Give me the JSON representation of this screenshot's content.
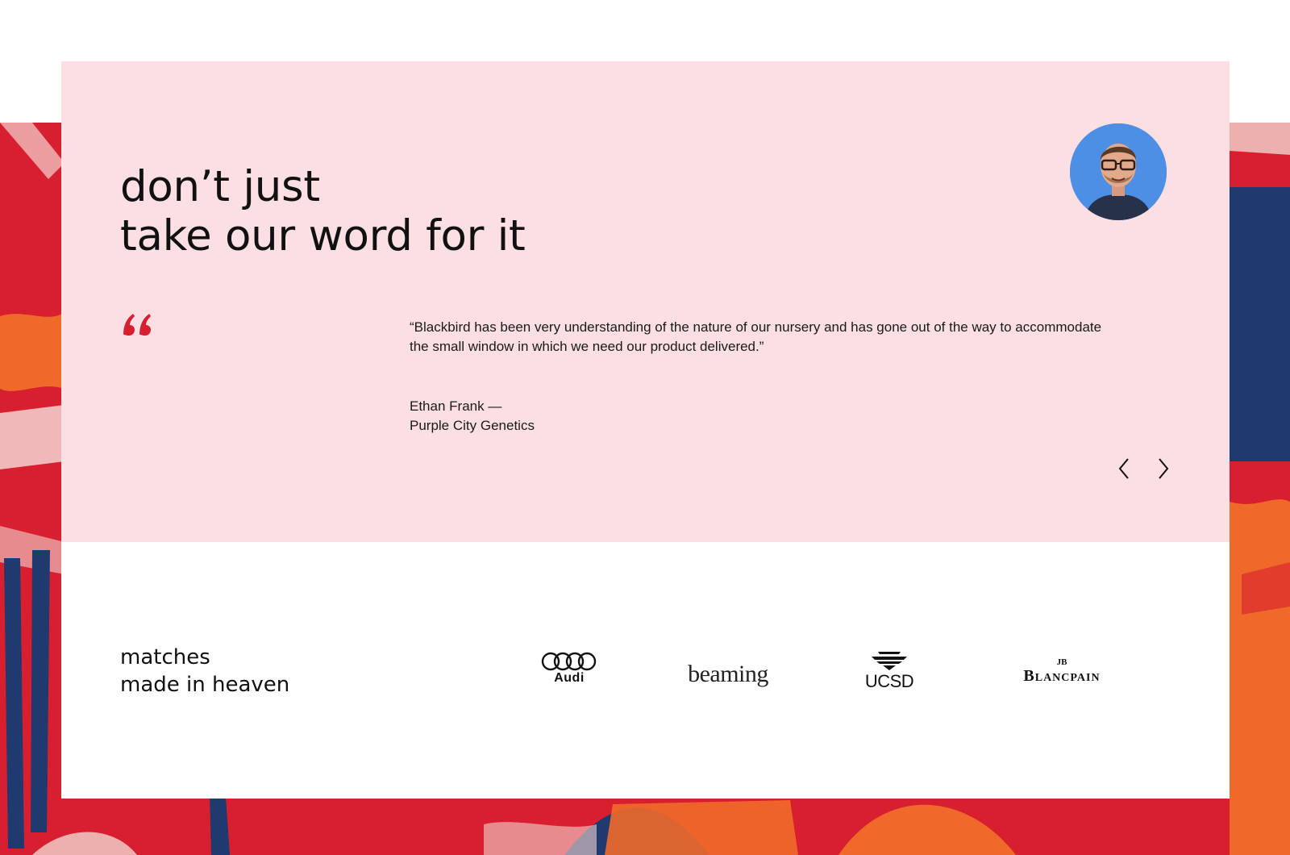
{
  "colors": {
    "accent": "#d81f2f",
    "testimonial_bg": "#fbdfe2",
    "art_navy": "#1f3a6e",
    "art_orange": "#ef6a2a",
    "avatar_bg": "#4e8fe6"
  },
  "testimonials": {
    "heading": [
      "don’t just",
      "take our word for it"
    ],
    "quote": "“Blackbird has been very understanding of the nature of our nursery and has gone out of the way to accommodate the small window in which we need our product delivered.”",
    "author_name": "Ethan Frank —",
    "author_company": "Purple City Genetics",
    "avatar": "person-photo",
    "quote_icon": "quote-mark-icon",
    "prev_icon": "chevron-left-icon",
    "next_icon": "chevron-right-icon"
  },
  "partners": {
    "heading": [
      "matches",
      "made in heaven"
    ],
    "logos": [
      {
        "name": "audi-logo",
        "text": "Audi"
      },
      {
        "name": "beaming-logo",
        "text": "beaming"
      },
      {
        "name": "ucsd-logo",
        "text": "UCSD"
      },
      {
        "name": "blancpain-logo",
        "text": "Blancpain",
        "mark": "JB"
      }
    ]
  }
}
